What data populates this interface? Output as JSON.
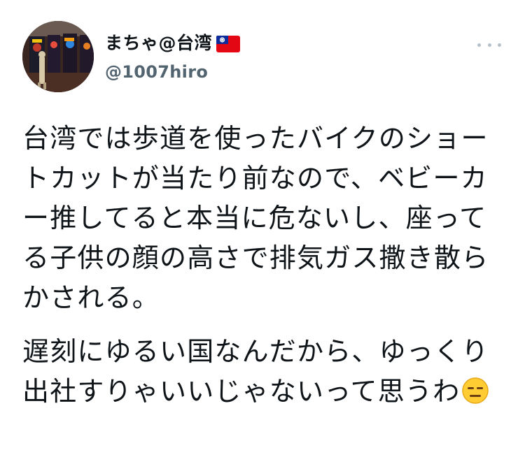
{
  "tweet": {
    "display_name": "まちゃ@台湾",
    "flag_icon": "taiwan-flag-icon",
    "handle": "@1007hiro",
    "more_icon": "more-options-icon",
    "paragraphs": [
      "台湾では歩道を使ったバイクのショートカットが当たり前なので、ベビーカー推してると本当に危ないし、座ってる子供の顔の高さで排気ガス撒き散らかされる。",
      "遅刻にゆるい国なんだから、ゆっくり出社すりゃいいじゃないって思うわ"
    ],
    "trailing_emoji": "expressionless-face-emoji",
    "colors": {
      "text": "#0f1419",
      "handle": "#536471",
      "more_dots": "#b6c0c8"
    }
  }
}
